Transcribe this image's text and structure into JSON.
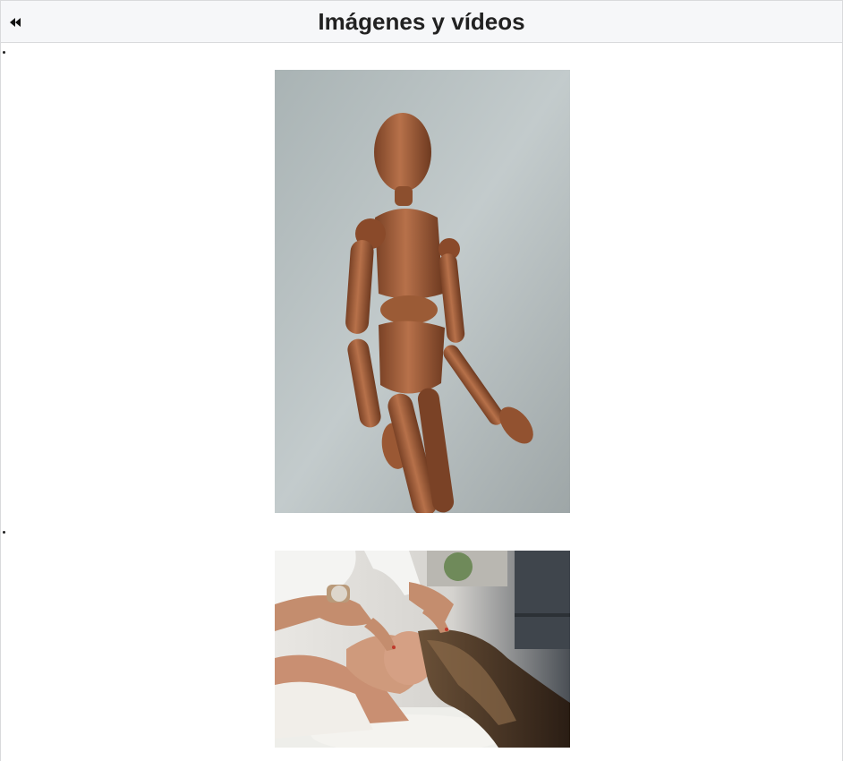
{
  "header": {
    "back_icon": "rewind-icon",
    "title": "Imágenes y vídeos"
  },
  "gallery": {
    "items": [
      {
        "subject": "wooden-mannequin-photo"
      },
      {
        "subject": "facial-massage-photo"
      }
    ]
  },
  "colors": {
    "header_bg": "#f6f7f9",
    "border": "#d9dadc",
    "title": "#222222"
  }
}
